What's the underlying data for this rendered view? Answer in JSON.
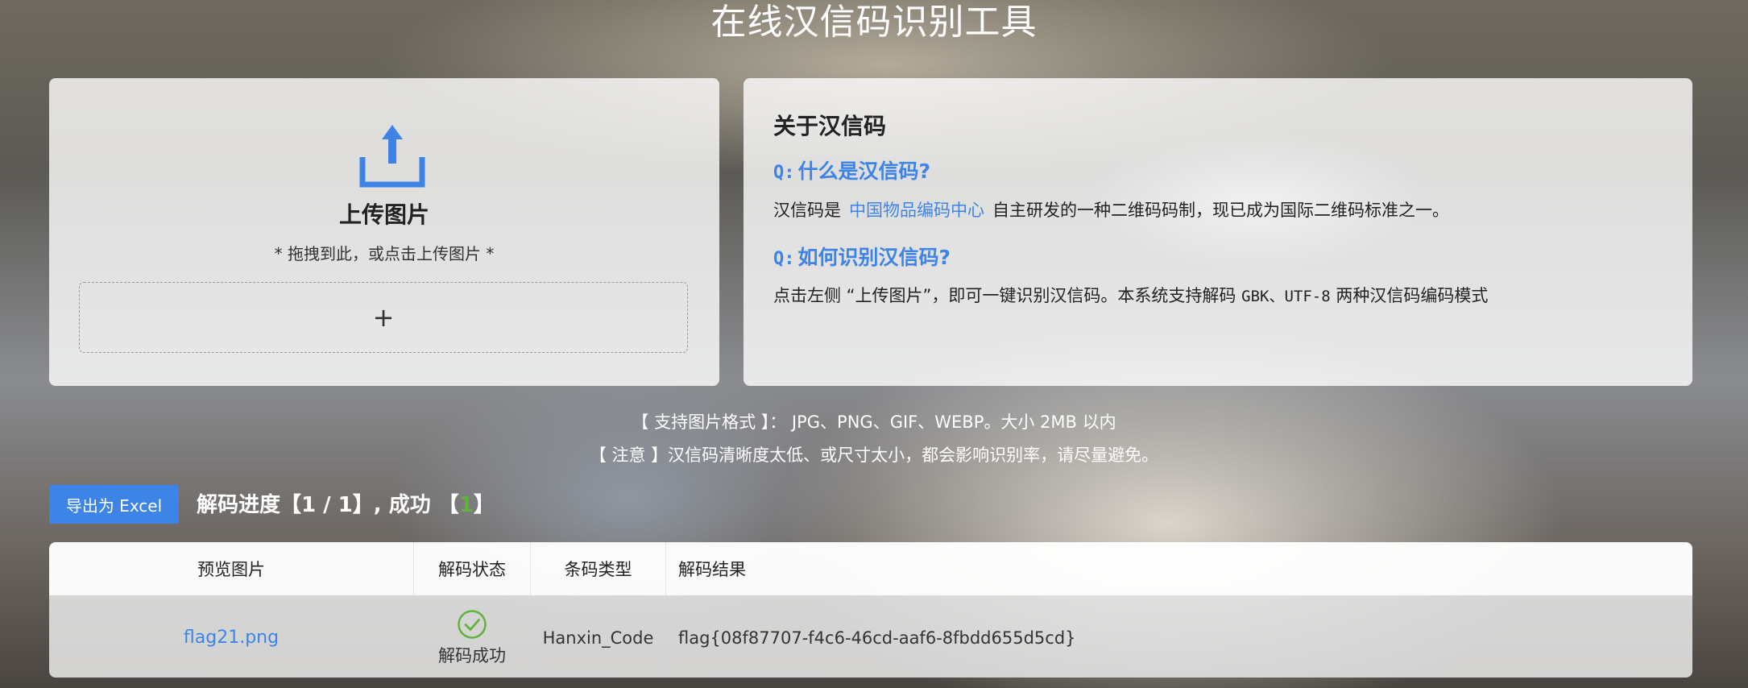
{
  "page": {
    "title": "在线汉信码识别工具"
  },
  "upload": {
    "title": "上传图片",
    "hint": "* 拖拽到此，或点击上传图片 *",
    "drop_symbol": "+",
    "icon": "upload-icon"
  },
  "about": {
    "title": "关于汉信码",
    "q_prefix": "Q:",
    "q1": "什么是汉信码?",
    "a1_before": "汉信码是",
    "a1_link": "中国物品编码中心",
    "a1_after": "自主研发的一种二维码码制，现已成为国际二维码标准之一。",
    "q2": "如何识别汉信码?",
    "a2_before": "点击左侧 “上传图片”，即可一键识别汉信码。本系统支持解码",
    "a2_codes": "GBK、UTF-8",
    "a2_after": "两种汉信码编码模式"
  },
  "notes": {
    "formats": "【 支持图片格式 】： JPG、PNG、GIF、WEBP。大小 2MB 以内",
    "warning": "【 注意 】汉信码清晰度太低、或尺寸太小，都会影响识别率，请尽量避免。"
  },
  "toolbar": {
    "export_label": "导出为 Excel",
    "progress_prefix": "解码进度【1 / 1】, 成功 【",
    "success_count": "1",
    "progress_suffix": "】"
  },
  "table": {
    "headers": [
      "预览图片",
      "解码状态",
      "条码类型",
      "解码结果"
    ],
    "rows": [
      {
        "file": "flag21.png",
        "status": "解码成功",
        "type": "Hanxin_Code",
        "result": "flag{08f87707-f4c6-46cd-aaf6-8fbdd655d5cd}"
      }
    ]
  },
  "colors": {
    "accent": "#3d84e6",
    "success": "#5fb33a"
  }
}
